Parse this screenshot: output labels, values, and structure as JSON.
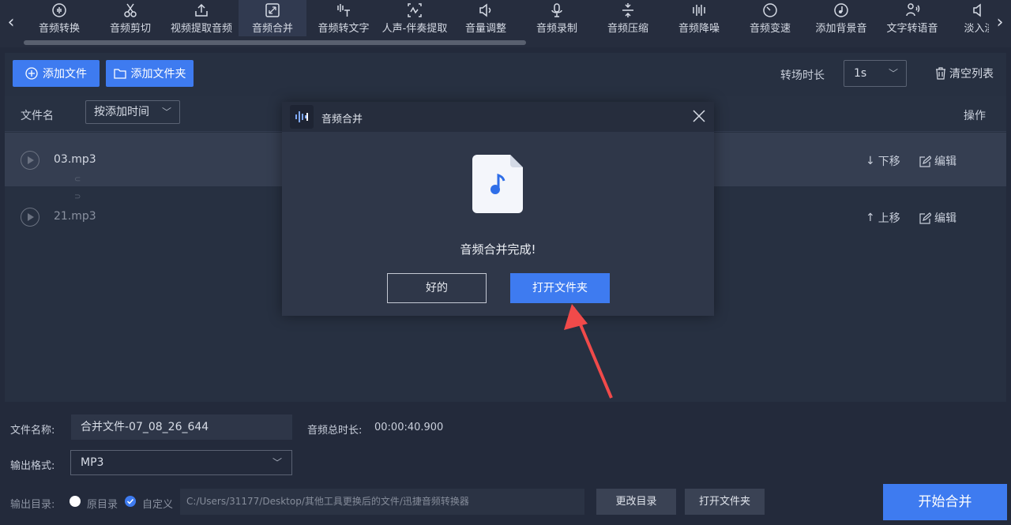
{
  "toolbar": {
    "tools": [
      {
        "label": "音频转换",
        "icon": "audio-convert-icon"
      },
      {
        "label": "音频剪切",
        "icon": "scissors-icon"
      },
      {
        "label": "视频提取音频",
        "icon": "upload-icon"
      },
      {
        "label": "音频合并",
        "icon": "merge-icon"
      },
      {
        "label": "音频转文字",
        "icon": "audio-to-text-icon"
      },
      {
        "label": "人声-伴奏提取",
        "icon": "vocal-extract-icon"
      },
      {
        "label": "音量调整",
        "icon": "volume-icon"
      },
      {
        "label": "音频录制",
        "icon": "microphone-icon"
      },
      {
        "label": "音频压缩",
        "icon": "compress-icon"
      },
      {
        "label": "音频降噪",
        "icon": "denoise-icon"
      },
      {
        "label": "音频变速",
        "icon": "speed-icon"
      },
      {
        "label": "添加背景音",
        "icon": "music-note-icon"
      },
      {
        "label": "文字转语音",
        "icon": "text-to-speech-icon"
      },
      {
        "label": "淡入淡",
        "icon": "fade-icon"
      }
    ],
    "active_index": 3
  },
  "actions": {
    "add_file": "添加文件",
    "add_folder": "添加文件夹",
    "transition_label": "转场时长",
    "transition_value": "1s",
    "clear_list": "清空列表"
  },
  "list": {
    "col_name": "文件名",
    "sort_value": "按添加时间",
    "col_op": "操作",
    "rows": [
      {
        "name": "03.mp3",
        "move": "下移",
        "edit": "编辑"
      },
      {
        "name": "21.mp3",
        "move": "上移",
        "edit": "编辑"
      }
    ]
  },
  "settings": {
    "filename_label": "文件名称:",
    "filename_value": "合并文件-07_08_26_644",
    "duration_label": "音频总时长:",
    "duration_value": "00:00:40.900",
    "format_label": "输出格式:",
    "format_value": "MP3",
    "output_label": "输出目录:",
    "radio_original": "原目录",
    "radio_custom": "自定义",
    "output_path": "C:/Users/31177/Desktop/其他工具更换后的文件/迅捷音频转换器",
    "change_dir": "更改目录",
    "open_folder": "打开文件夹",
    "start": "开始合并"
  },
  "dialog": {
    "title": "音频合并",
    "message": "音频合并完成!",
    "ok": "好的",
    "open_folder": "打开文件夹"
  },
  "colors": {
    "accent": "#3e7bf0",
    "annotation_arrow": "#f04a4a",
    "background": "#232a3b"
  }
}
